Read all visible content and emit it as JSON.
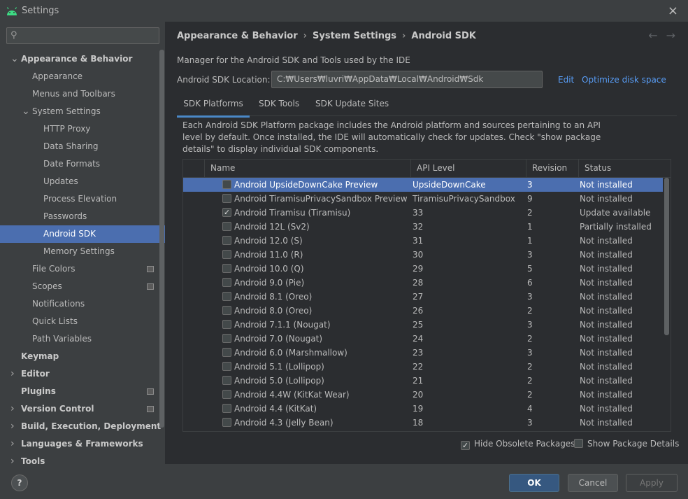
{
  "window": {
    "title": "Settings",
    "close_icon": "×"
  },
  "search": {
    "placeholder": "",
    "icon": "⚲"
  },
  "sidebar": {
    "items": [
      {
        "label": "Appearance & Behavior",
        "level": 0,
        "expanded": true,
        "bold": true
      },
      {
        "label": "Appearance",
        "level": 1
      },
      {
        "label": "Menus and Toolbars",
        "level": 1
      },
      {
        "label": "System Settings",
        "level": 1,
        "expanded": true
      },
      {
        "label": "HTTP Proxy",
        "level": 2
      },
      {
        "label": "Data Sharing",
        "level": 2
      },
      {
        "label": "Date Formats",
        "level": 2
      },
      {
        "label": "Updates",
        "level": 2
      },
      {
        "label": "Process Elevation",
        "level": 2
      },
      {
        "label": "Passwords",
        "level": 2
      },
      {
        "label": "Android SDK",
        "level": 2,
        "selected": true
      },
      {
        "label": "Memory Settings",
        "level": 2
      },
      {
        "label": "File Colors",
        "level": 1,
        "project": true
      },
      {
        "label": "Scopes",
        "level": 1,
        "project": true
      },
      {
        "label": "Notifications",
        "level": 1
      },
      {
        "label": "Quick Lists",
        "level": 1
      },
      {
        "label": "Path Variables",
        "level": 1
      },
      {
        "label": "Keymap",
        "level": 0,
        "bold": true
      },
      {
        "label": "Editor",
        "level": 0,
        "collapsed": true,
        "bold": true
      },
      {
        "label": "Plugins",
        "level": 0,
        "bold": true,
        "project": true
      },
      {
        "label": "Version Control",
        "level": 0,
        "collapsed": true,
        "bold": true,
        "project": true
      },
      {
        "label": "Build, Execution, Deployment",
        "level": 0,
        "collapsed": true,
        "bold": true
      },
      {
        "label": "Languages & Frameworks",
        "level": 0,
        "collapsed": true,
        "bold": true
      },
      {
        "label": "Tools",
        "level": 0,
        "collapsed": true,
        "bold": true
      }
    ]
  },
  "breadcrumb": {
    "part1": "Appearance & Behavior",
    "part2": "System Settings",
    "part3": "Android SDK",
    "sep": "›"
  },
  "nav": {
    "back": "←",
    "forward": "→"
  },
  "main": {
    "description": "Manager for the Android SDK and Tools used by the IDE",
    "location_label": "Android SDK Location:",
    "location_value": "C:₩Users₩luvri₩AppData₩Local₩Android₩Sdk",
    "edit_link": "Edit",
    "optimize_link": "Optimize disk space"
  },
  "tabs": [
    "SDK Platforms",
    "SDK Tools",
    "SDK Update Sites"
  ],
  "panel": {
    "description": "Each Android SDK Platform package includes the Android platform and sources pertaining to an API level by default. Once installed, the IDE will automatically check for updates. Check \"show package details\" to display individual SDK components."
  },
  "table": {
    "headers": [
      "Name",
      "API Level",
      "Revision",
      "Status"
    ],
    "rows": [
      {
        "name": "Android UpsideDownCake Preview",
        "api": "UpsideDownCake",
        "rev": "3",
        "status": "Not installed",
        "checked": false,
        "selected": true
      },
      {
        "name": "Android TiramisuPrivacySandbox Preview",
        "api": "TiramisuPrivacySandbox",
        "rev": "9",
        "status": "Not installed",
        "checked": false
      },
      {
        "name": "Android Tiramisu (Tiramisu)",
        "api": "33",
        "rev": "2",
        "status": "Update available",
        "checked": true
      },
      {
        "name": "Android 12L (Sv2)",
        "api": "32",
        "rev": "1",
        "status": "Partially installed",
        "checked": false
      },
      {
        "name": "Android 12.0 (S)",
        "api": "31",
        "rev": "1",
        "status": "Not installed",
        "checked": false
      },
      {
        "name": "Android 11.0 (R)",
        "api": "30",
        "rev": "3",
        "status": "Not installed",
        "checked": false
      },
      {
        "name": "Android 10.0 (Q)",
        "api": "29",
        "rev": "5",
        "status": "Not installed",
        "checked": false
      },
      {
        "name": "Android 9.0 (Pie)",
        "api": "28",
        "rev": "6",
        "status": "Not installed",
        "checked": false
      },
      {
        "name": "Android 8.1 (Oreo)",
        "api": "27",
        "rev": "3",
        "status": "Not installed",
        "checked": false
      },
      {
        "name": "Android 8.0 (Oreo)",
        "api": "26",
        "rev": "2",
        "status": "Not installed",
        "checked": false
      },
      {
        "name": "Android 7.1.1 (Nougat)",
        "api": "25",
        "rev": "3",
        "status": "Not installed",
        "checked": false
      },
      {
        "name": "Android 7.0 (Nougat)",
        "api": "24",
        "rev": "2",
        "status": "Not installed",
        "checked": false
      },
      {
        "name": "Android 6.0 (Marshmallow)",
        "api": "23",
        "rev": "3",
        "status": "Not installed",
        "checked": false
      },
      {
        "name": "Android 5.1 (Lollipop)",
        "api": "22",
        "rev": "2",
        "status": "Not installed",
        "checked": false
      },
      {
        "name": "Android 5.0 (Lollipop)",
        "api": "21",
        "rev": "2",
        "status": "Not installed",
        "checked": false
      },
      {
        "name": "Android 4.4W (KitKat Wear)",
        "api": "20",
        "rev": "2",
        "status": "Not installed",
        "checked": false
      },
      {
        "name": "Android 4.4 (KitKat)",
        "api": "19",
        "rev": "4",
        "status": "Not installed",
        "checked": false
      },
      {
        "name": "Android 4.3 (Jelly Bean)",
        "api": "18",
        "rev": "3",
        "status": "Not installed",
        "checked": false
      }
    ]
  },
  "options": {
    "hide_obsolete": "Hide Obsolete Packages",
    "hide_obsolete_checked": true,
    "show_details": "Show Package Details",
    "show_details_checked": false
  },
  "buttons": {
    "help": "?",
    "ok": "OK",
    "cancel": "Cancel",
    "apply": "Apply"
  },
  "colors": {
    "accent": "#4b6eaf",
    "link": "#589df6",
    "android_green": "#3ddc84"
  }
}
